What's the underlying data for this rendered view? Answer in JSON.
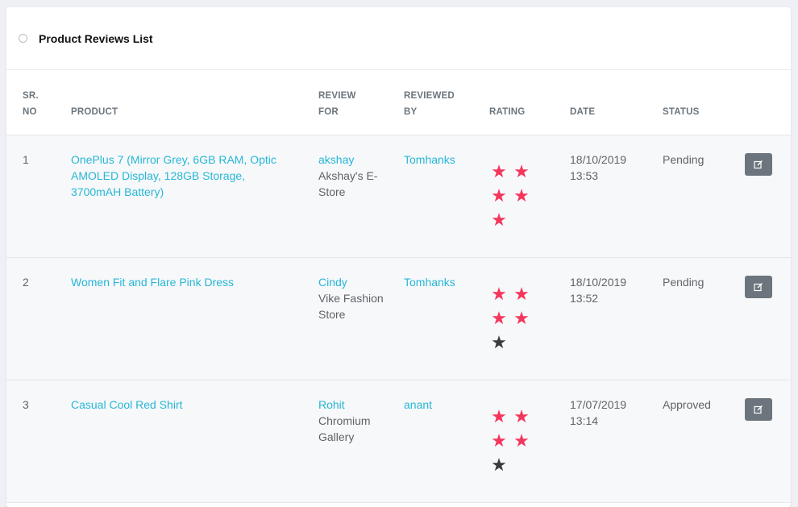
{
  "card": {
    "title": "Product Reviews List"
  },
  "columns": {
    "sr_line1": "SR.",
    "sr_line2": "NO",
    "product": "PRODUCT",
    "review_for_line1": "REVIEW",
    "review_for_line2": "FOR",
    "reviewed_by_line1": "REVIEWED",
    "reviewed_by_line2": "BY",
    "rating": "RATING",
    "date": "DATE",
    "status": "STATUS"
  },
  "rows": [
    {
      "sr": "1",
      "product": "OnePlus 7 (Mirror Grey, 6GB RAM, Optic AMOLED Display, 128GB Storage, 3700mAH Battery)",
      "review_for_name": "akshay",
      "review_for_store": "Akshay's E-Store",
      "reviewed_by": "Tomhanks",
      "rating": 5,
      "date": "18/10/2019 13:53",
      "status": "Pending"
    },
    {
      "sr": "2",
      "product": "Women Fit and Flare Pink Dress",
      "review_for_name": "Cindy",
      "review_for_store": "Vike Fashion Store",
      "reviewed_by": "Tomhanks",
      "rating": 4,
      "date": "18/10/2019 13:52",
      "status": "Pending"
    },
    {
      "sr": "3",
      "product": "Casual Cool Red Shirt",
      "review_for_name": "Rohit",
      "review_for_store": "Chromium Gallery",
      "reviewed_by": "anant",
      "rating": 4,
      "date": "17/07/2019 13:14",
      "status": "Approved"
    }
  ],
  "rating_max": 5,
  "icons": {
    "star": "star-icon",
    "edit": "edit-icon",
    "header": "circle-icon"
  },
  "colors": {
    "link": "#26b7d6",
    "star_filled": "#f5365c",
    "star_empty": "#3a3a3a",
    "edit_button": "#6c757d"
  }
}
